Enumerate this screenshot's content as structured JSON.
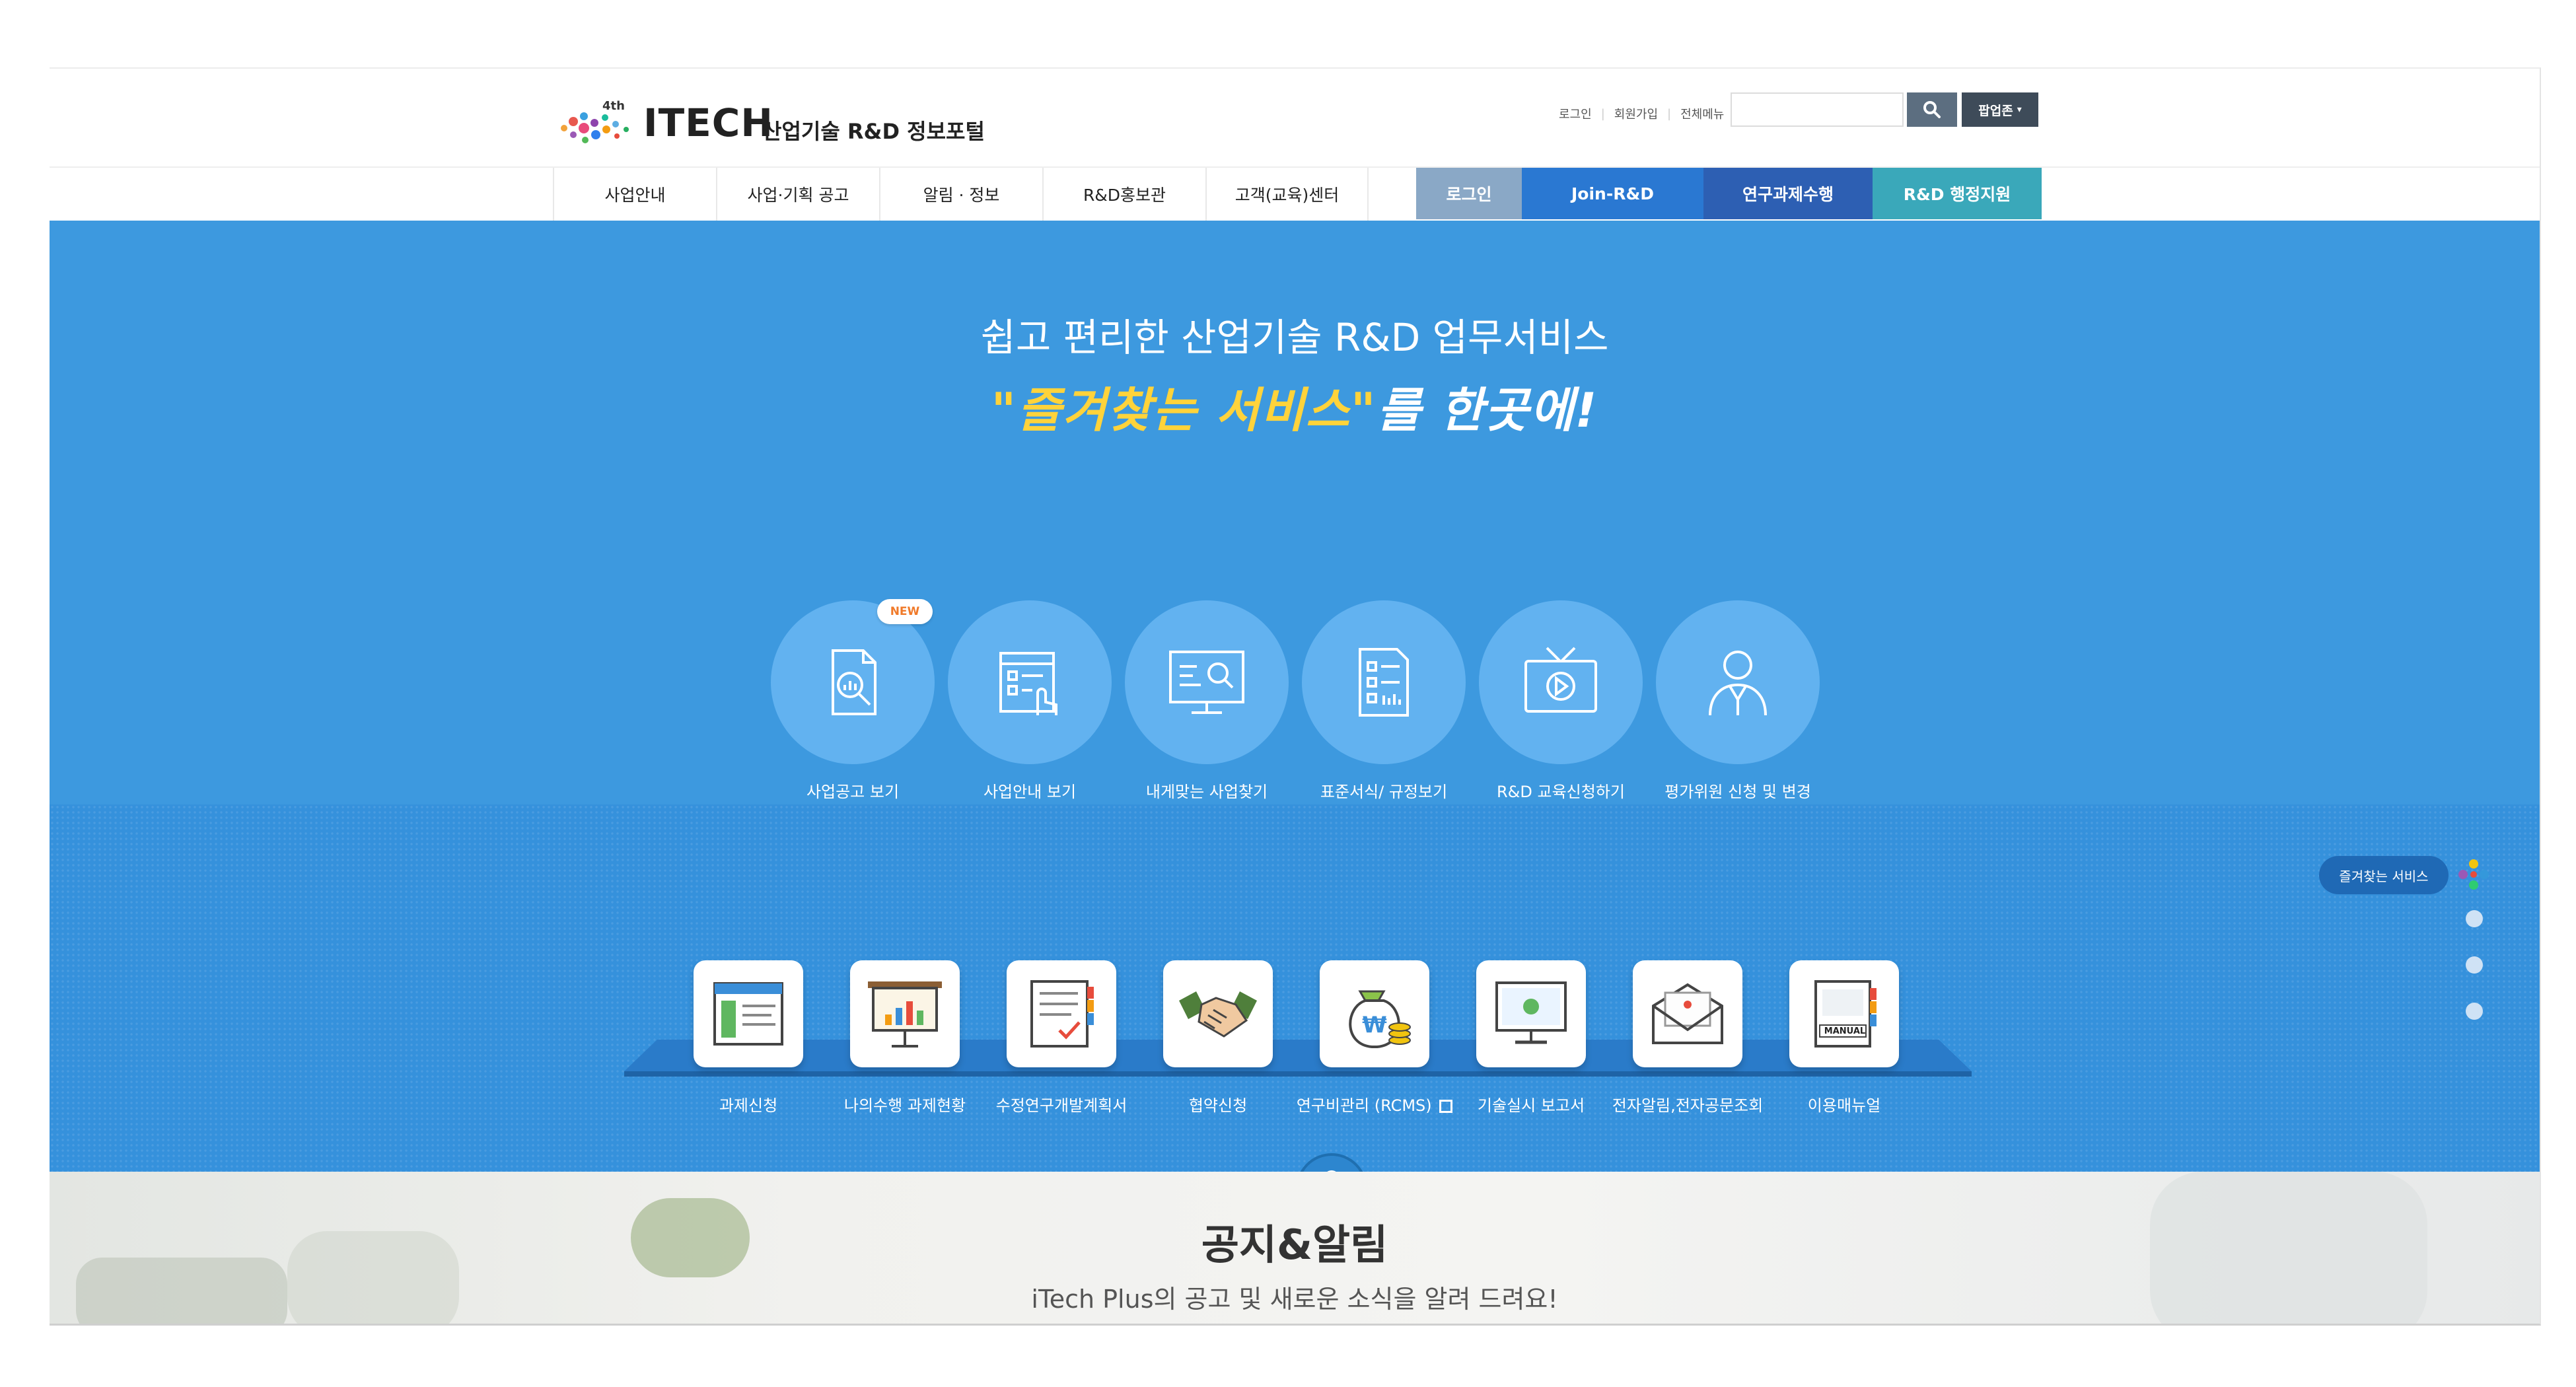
{
  "header": {
    "brand": "ITECH",
    "brand_sup": "4th",
    "subtitle": "산업기술 R&D 정보포털",
    "util_links": [
      "로그인",
      "회원가입",
      "전체메뉴"
    ],
    "search_placeholder": "",
    "popup_label": "팝업존"
  },
  "nav": {
    "items": [
      "사업안내",
      "사업·기획 공고",
      "알림 · 정보",
      "R&D홍보관",
      "고객(교육)센터"
    ],
    "colored": [
      "로그인",
      "Join-R&D",
      "연구과제수행",
      "R&D 행정지원"
    ],
    "colors": [
      "#8aa8c6",
      "#2a78d2",
      "#2d5fb3",
      "#3aa8ba"
    ]
  },
  "hero": {
    "title": "쉽고 편리한 산업기술 R&D 업무서비스",
    "slogan_quote_open": "\"",
    "slogan_highlight": "즐겨찾는 서비스",
    "slogan_quote_close": "\"",
    "slogan_rest": "를 한곳에!",
    "new_badge": "NEW",
    "services": [
      {
        "label": "사업공고 보기",
        "icon": "document-search-icon"
      },
      {
        "label": "사업안내 보기",
        "icon": "checklist-touch-icon"
      },
      {
        "label": "내게맞는 사업찾기",
        "icon": "monitor-search-icon"
      },
      {
        "label": "표준서식/ 규정보기",
        "icon": "form-document-icon"
      },
      {
        "label": "R&D 교육신청하기",
        "icon": "tv-play-icon"
      },
      {
        "label": "평가위원 신청 및 변경",
        "icon": "person-suit-icon"
      }
    ],
    "quick_menu": [
      {
        "label": "과제신청",
        "icon": "application-window-icon"
      },
      {
        "label": "나의수행 과제현황",
        "icon": "presentation-chart-icon"
      },
      {
        "label": "수정연구개발계획서",
        "icon": "plan-book-icon"
      },
      {
        "label": "협약신청",
        "icon": "handshake-icon"
      },
      {
        "label": "연구비관리 (RCMS)",
        "icon": "money-bag-icon"
      },
      {
        "label": "기술실시 보고서",
        "icon": "computer-report-icon"
      },
      {
        "label": "전자알림,전자공문조회",
        "icon": "envelope-icon"
      },
      {
        "label": "이용매뉴얼",
        "icon": "manual-book-icon"
      }
    ],
    "manual_text": "MANUAL"
  },
  "side": {
    "fav_label": "즐겨찾는 서비스"
  },
  "notice": {
    "title": "공지&알림",
    "subtitle": "iTech Plus의 공고 및 새로운 소식을 알려 드려요!"
  }
}
